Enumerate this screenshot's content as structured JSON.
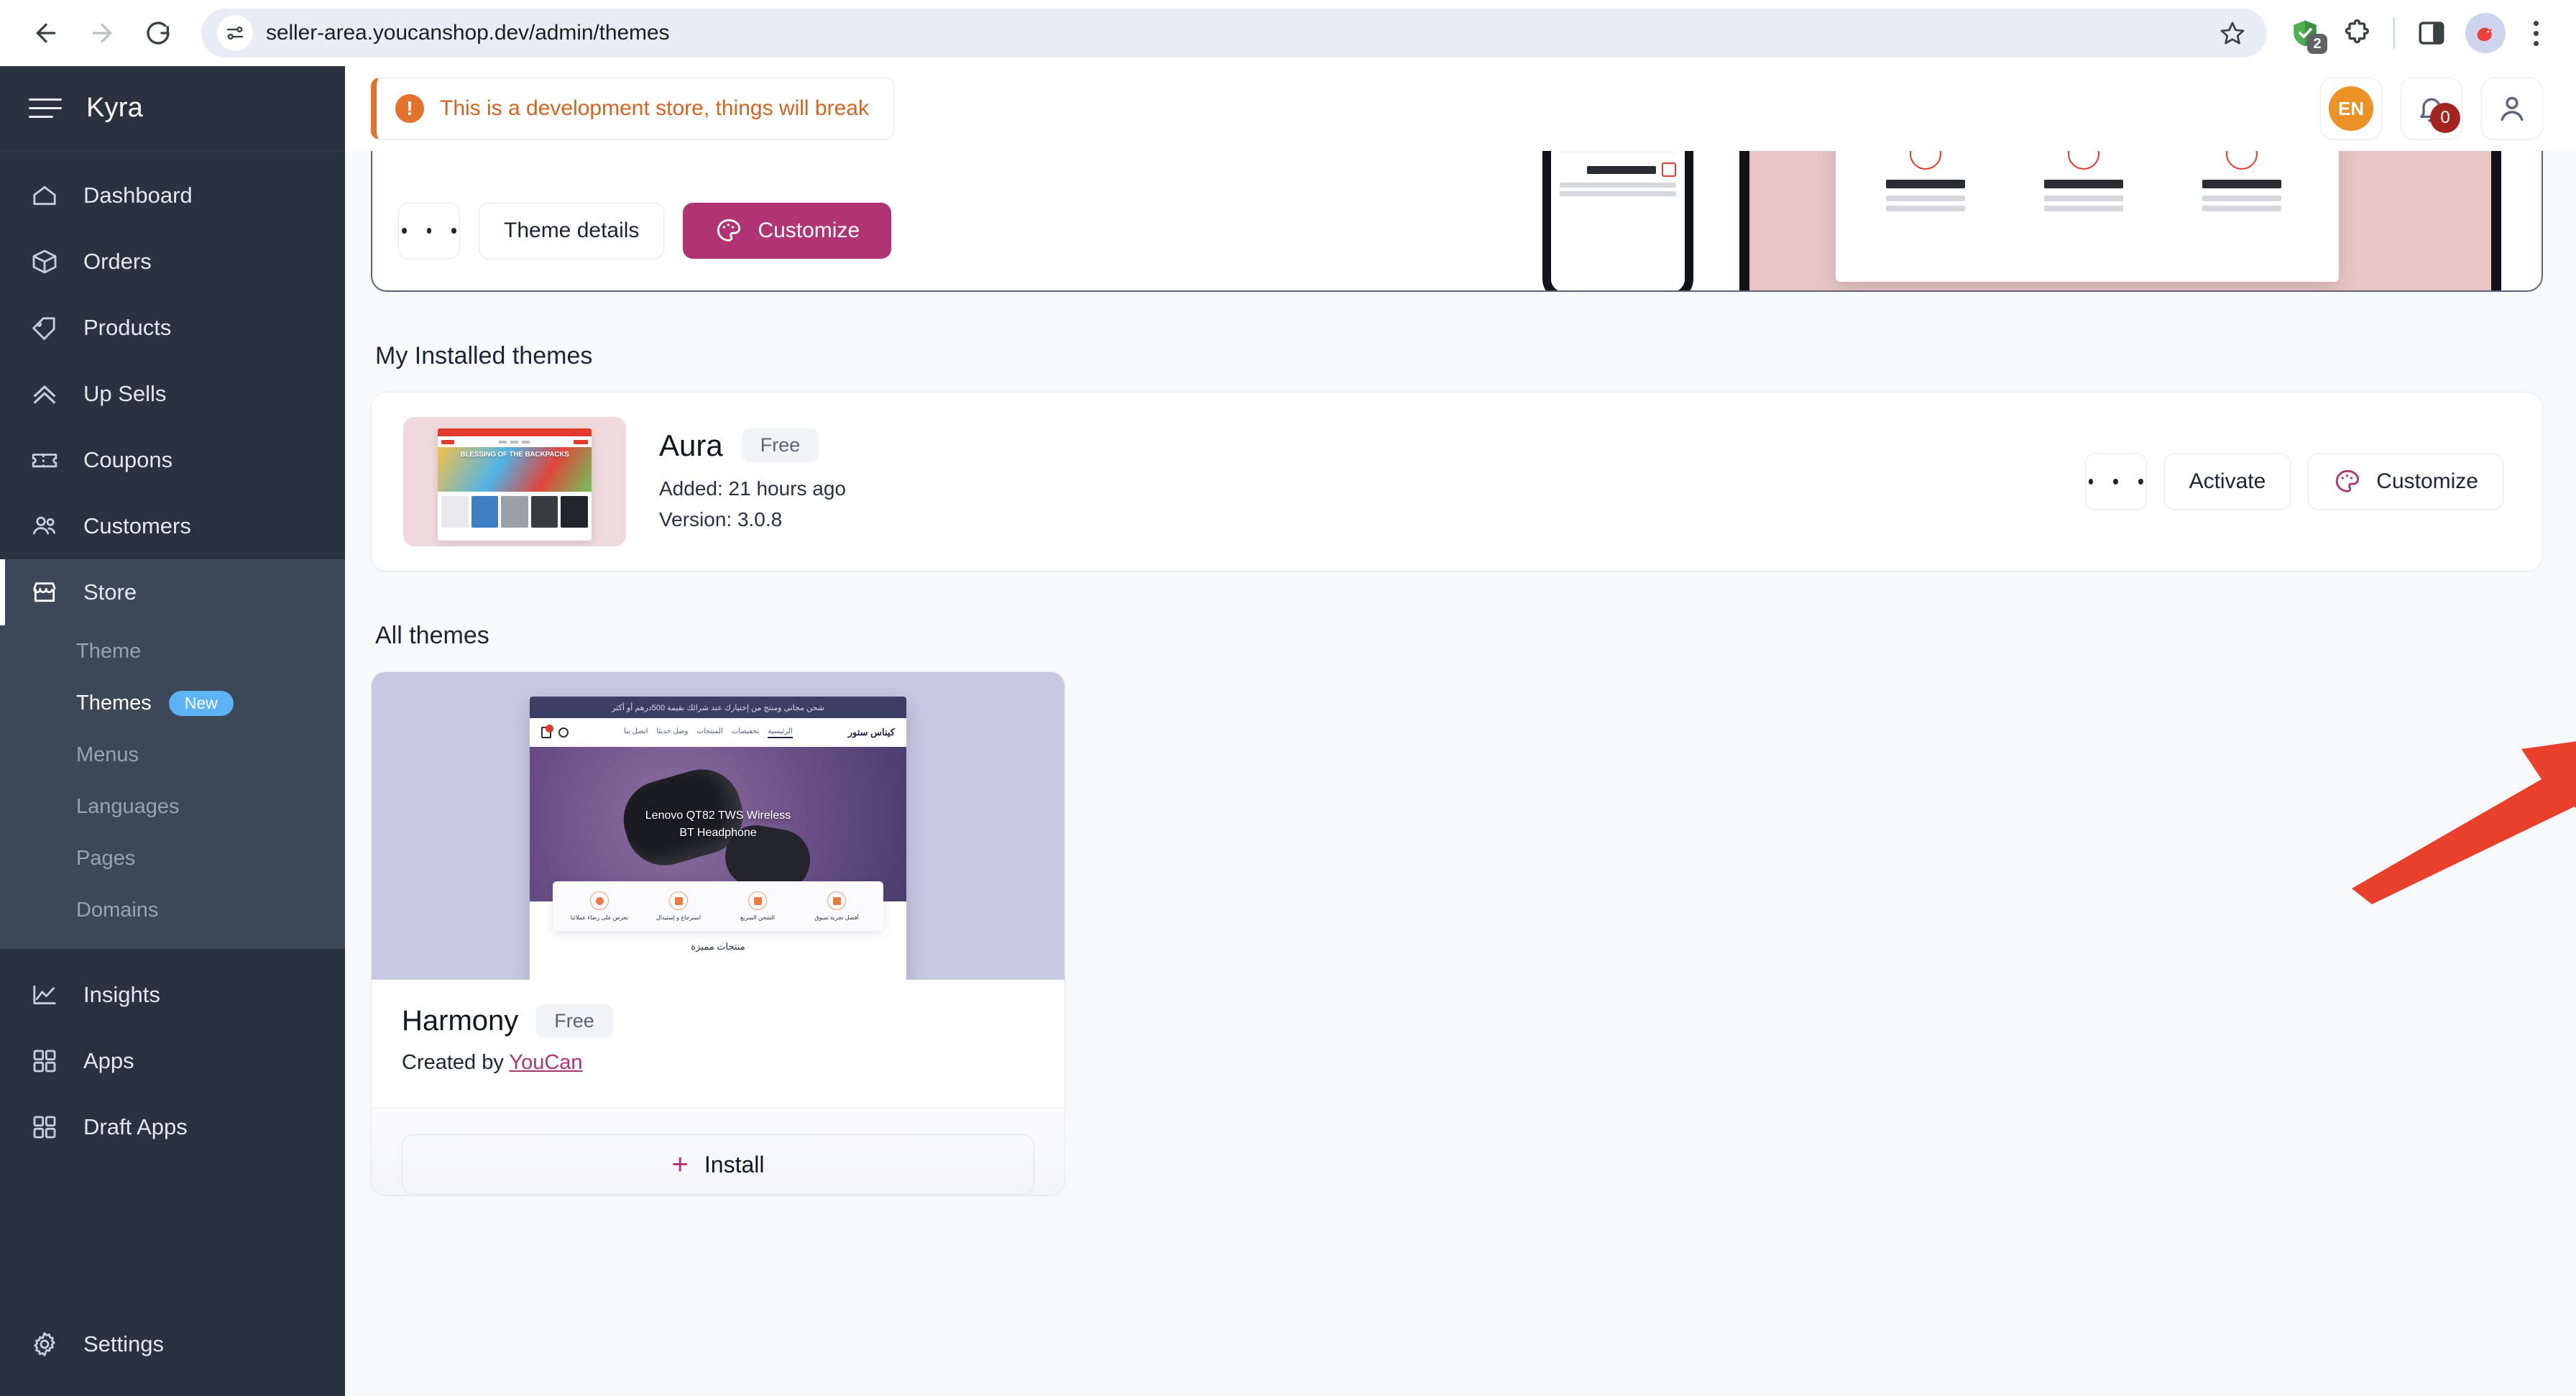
{
  "browser": {
    "url": "seller-area.youcanshop.dev/admin/themes",
    "back_icon": "back-arrow-icon",
    "forward_icon": "forward-arrow-icon",
    "reload_icon": "reload-icon",
    "site_info_icon": "site-settings-icon",
    "bookmark_icon": "star-icon",
    "extension_shield_badge": "2",
    "extensions_icon": "puzzle-icon",
    "side_panel_icon": "side-panel-icon",
    "profile_icon": "bird-avatar-icon",
    "menu_icon": "three-dot-menu-icon"
  },
  "sidebar": {
    "brand": "Kyra",
    "menu_icon": "hamburger-icon",
    "items": [
      {
        "label": "Dashboard",
        "icon": "home-icon"
      },
      {
        "label": "Orders",
        "icon": "box-icon"
      },
      {
        "label": "Products",
        "icon": "tag-icon"
      },
      {
        "label": "Up Sells",
        "icon": "chevrons-up-icon"
      },
      {
        "label": "Coupons",
        "icon": "ticket-icon"
      },
      {
        "label": "Customers",
        "icon": "users-icon"
      },
      {
        "label": "Store",
        "icon": "storefront-icon",
        "active": true
      }
    ],
    "submenu": [
      {
        "label": "Theme"
      },
      {
        "label": "Themes",
        "badge": "New",
        "current": true
      },
      {
        "label": "Menus"
      },
      {
        "label": "Languages"
      },
      {
        "label": "Pages"
      },
      {
        "label": "Domains"
      }
    ],
    "items_after": [
      {
        "label": "Insights",
        "icon": "line-chart-icon"
      },
      {
        "label": "Apps",
        "icon": "grid-icon"
      },
      {
        "label": "Draft Apps",
        "icon": "grid-icon"
      }
    ],
    "settings": {
      "label": "Settings",
      "icon": "gear-icon"
    }
  },
  "topbar": {
    "dev_banner": "This is a development store, things will break",
    "warn_icon": "alert-icon",
    "language": "EN",
    "notifications_count": "0",
    "bell_icon": "bell-icon",
    "account_icon": "user-icon"
  },
  "active_theme_card": {
    "more_label": "•••",
    "details_label": "Theme details",
    "customize_label": "Customize",
    "customize_icon": "palette-icon",
    "preview_alt": "arabic-fashion-store-preview"
  },
  "installed": {
    "heading": "My Installed themes",
    "theme": {
      "name": "Aura",
      "price_badge": "Free",
      "added": "Added: 21 hours ago",
      "version": "Version: 3.0.8",
      "thumb_headline": "BLESSING OF THE BACKPACKS",
      "actions": {
        "more_label": "•••",
        "activate_label": "Activate",
        "customize_label": "Customize",
        "customize_icon": "palette-icon"
      }
    }
  },
  "all_themes": {
    "heading": "All themes",
    "cards": [
      {
        "name": "Harmony",
        "price_badge": "Free",
        "created_prefix": "Created by",
        "creator": "YouCan",
        "install_label": "Install",
        "install_icon": "plus-icon",
        "preview_headline_1": "Lenovo QT82 TWS Wireless",
        "preview_headline_2": "BT Headphone",
        "preview_store_name": "كيناس ستور",
        "preview_section": "منتجات مميزة",
        "preview_topbar": "شحن مجاني ومنتج من إختيارك عند شرائك بقيمة 500درهم أو أكثر"
      }
    ]
  },
  "annotation": {
    "arrow_color": "#E8402A",
    "points_at": "Customize"
  },
  "colors": {
    "sidebar_bg": "#2a3240",
    "sidebar_active": "#3c4757",
    "accent_magenta": "#b03473",
    "badge_blue": "#5eb3f5",
    "warn_orange": "#d2641f",
    "lang_orange": "#eb9126",
    "bell_red": "#a32420",
    "page_bg": "#f8f9fb"
  }
}
